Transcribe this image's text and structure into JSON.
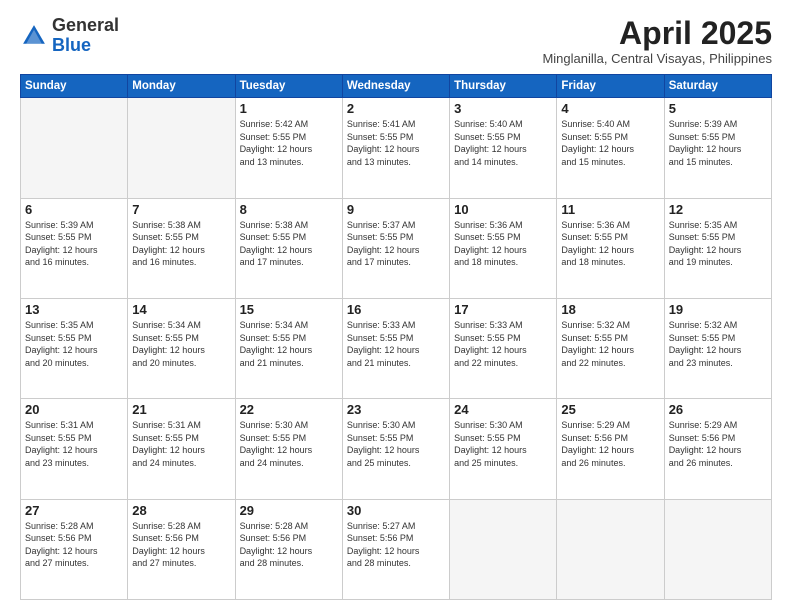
{
  "header": {
    "logo_general": "General",
    "logo_blue": "Blue",
    "month_title": "April 2025",
    "location": "Minglanilla, Central Visayas, Philippines"
  },
  "weekdays": [
    "Sunday",
    "Monday",
    "Tuesday",
    "Wednesday",
    "Thursday",
    "Friday",
    "Saturday"
  ],
  "weeks": [
    [
      {
        "day": "",
        "detail": ""
      },
      {
        "day": "",
        "detail": ""
      },
      {
        "day": "1",
        "detail": "Sunrise: 5:42 AM\nSunset: 5:55 PM\nDaylight: 12 hours\nand 13 minutes."
      },
      {
        "day": "2",
        "detail": "Sunrise: 5:41 AM\nSunset: 5:55 PM\nDaylight: 12 hours\nand 13 minutes."
      },
      {
        "day": "3",
        "detail": "Sunrise: 5:40 AM\nSunset: 5:55 PM\nDaylight: 12 hours\nand 14 minutes."
      },
      {
        "day": "4",
        "detail": "Sunrise: 5:40 AM\nSunset: 5:55 PM\nDaylight: 12 hours\nand 15 minutes."
      },
      {
        "day": "5",
        "detail": "Sunrise: 5:39 AM\nSunset: 5:55 PM\nDaylight: 12 hours\nand 15 minutes."
      }
    ],
    [
      {
        "day": "6",
        "detail": "Sunrise: 5:39 AM\nSunset: 5:55 PM\nDaylight: 12 hours\nand 16 minutes."
      },
      {
        "day": "7",
        "detail": "Sunrise: 5:38 AM\nSunset: 5:55 PM\nDaylight: 12 hours\nand 16 minutes."
      },
      {
        "day": "8",
        "detail": "Sunrise: 5:38 AM\nSunset: 5:55 PM\nDaylight: 12 hours\nand 17 minutes."
      },
      {
        "day": "9",
        "detail": "Sunrise: 5:37 AM\nSunset: 5:55 PM\nDaylight: 12 hours\nand 17 minutes."
      },
      {
        "day": "10",
        "detail": "Sunrise: 5:36 AM\nSunset: 5:55 PM\nDaylight: 12 hours\nand 18 minutes."
      },
      {
        "day": "11",
        "detail": "Sunrise: 5:36 AM\nSunset: 5:55 PM\nDaylight: 12 hours\nand 18 minutes."
      },
      {
        "day": "12",
        "detail": "Sunrise: 5:35 AM\nSunset: 5:55 PM\nDaylight: 12 hours\nand 19 minutes."
      }
    ],
    [
      {
        "day": "13",
        "detail": "Sunrise: 5:35 AM\nSunset: 5:55 PM\nDaylight: 12 hours\nand 20 minutes."
      },
      {
        "day": "14",
        "detail": "Sunrise: 5:34 AM\nSunset: 5:55 PM\nDaylight: 12 hours\nand 20 minutes."
      },
      {
        "day": "15",
        "detail": "Sunrise: 5:34 AM\nSunset: 5:55 PM\nDaylight: 12 hours\nand 21 minutes."
      },
      {
        "day": "16",
        "detail": "Sunrise: 5:33 AM\nSunset: 5:55 PM\nDaylight: 12 hours\nand 21 minutes."
      },
      {
        "day": "17",
        "detail": "Sunrise: 5:33 AM\nSunset: 5:55 PM\nDaylight: 12 hours\nand 22 minutes."
      },
      {
        "day": "18",
        "detail": "Sunrise: 5:32 AM\nSunset: 5:55 PM\nDaylight: 12 hours\nand 22 minutes."
      },
      {
        "day": "19",
        "detail": "Sunrise: 5:32 AM\nSunset: 5:55 PM\nDaylight: 12 hours\nand 23 minutes."
      }
    ],
    [
      {
        "day": "20",
        "detail": "Sunrise: 5:31 AM\nSunset: 5:55 PM\nDaylight: 12 hours\nand 23 minutes."
      },
      {
        "day": "21",
        "detail": "Sunrise: 5:31 AM\nSunset: 5:55 PM\nDaylight: 12 hours\nand 24 minutes."
      },
      {
        "day": "22",
        "detail": "Sunrise: 5:30 AM\nSunset: 5:55 PM\nDaylight: 12 hours\nand 24 minutes."
      },
      {
        "day": "23",
        "detail": "Sunrise: 5:30 AM\nSunset: 5:55 PM\nDaylight: 12 hours\nand 25 minutes."
      },
      {
        "day": "24",
        "detail": "Sunrise: 5:30 AM\nSunset: 5:55 PM\nDaylight: 12 hours\nand 25 minutes."
      },
      {
        "day": "25",
        "detail": "Sunrise: 5:29 AM\nSunset: 5:56 PM\nDaylight: 12 hours\nand 26 minutes."
      },
      {
        "day": "26",
        "detail": "Sunrise: 5:29 AM\nSunset: 5:56 PM\nDaylight: 12 hours\nand 26 minutes."
      }
    ],
    [
      {
        "day": "27",
        "detail": "Sunrise: 5:28 AM\nSunset: 5:56 PM\nDaylight: 12 hours\nand 27 minutes."
      },
      {
        "day": "28",
        "detail": "Sunrise: 5:28 AM\nSunset: 5:56 PM\nDaylight: 12 hours\nand 27 minutes."
      },
      {
        "day": "29",
        "detail": "Sunrise: 5:28 AM\nSunset: 5:56 PM\nDaylight: 12 hours\nand 28 minutes."
      },
      {
        "day": "30",
        "detail": "Sunrise: 5:27 AM\nSunset: 5:56 PM\nDaylight: 12 hours\nand 28 minutes."
      },
      {
        "day": "",
        "detail": ""
      },
      {
        "day": "",
        "detail": ""
      },
      {
        "day": "",
        "detail": ""
      }
    ]
  ]
}
